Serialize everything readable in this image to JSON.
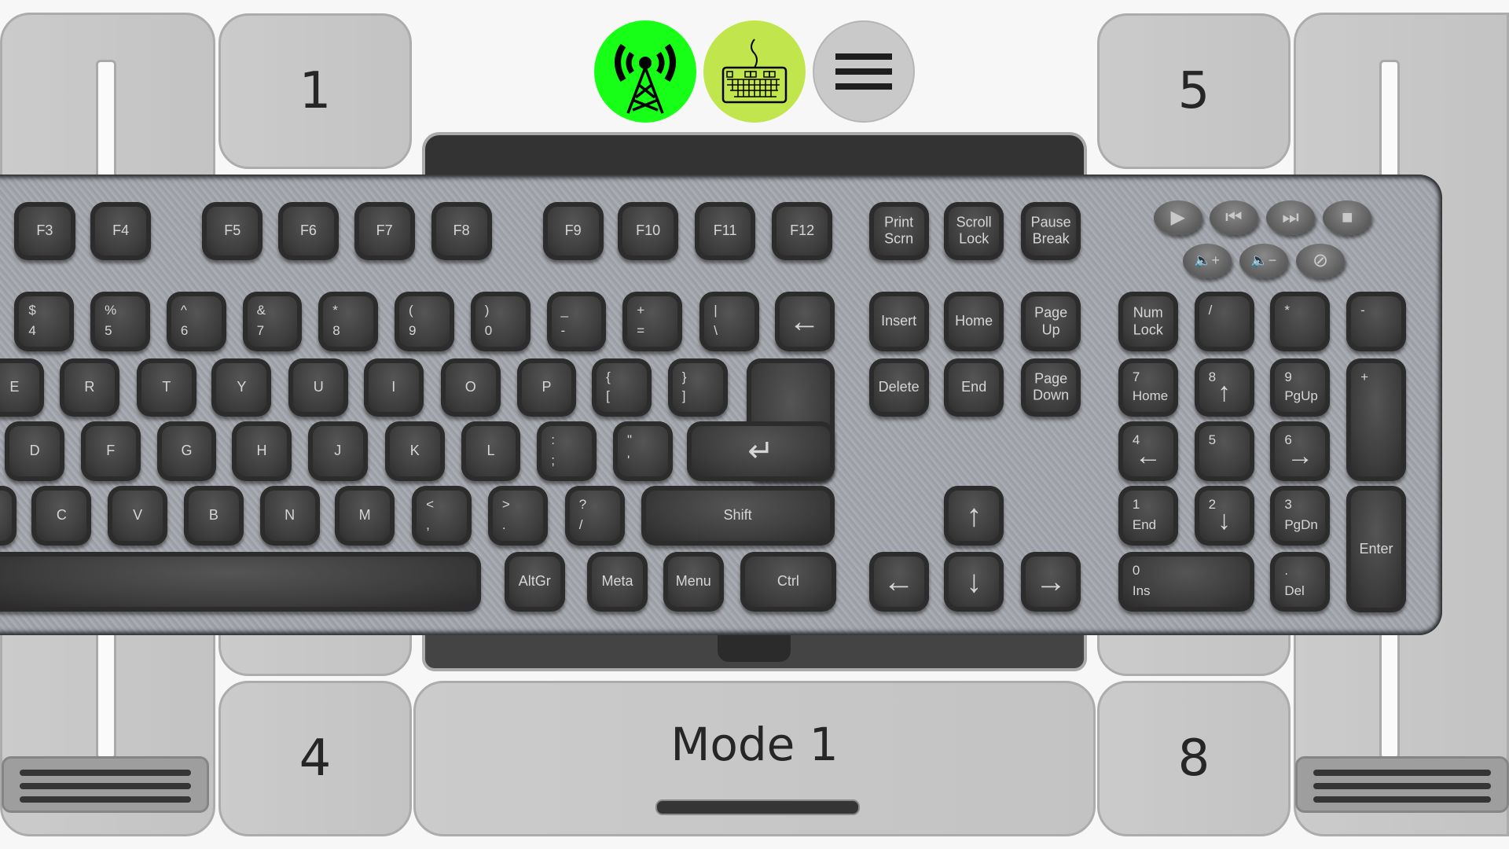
{
  "side_pads": {
    "top_left": "1",
    "top_right": "5",
    "bottom_left": "4",
    "bottom_right": "8",
    "mode_label": "Mode 1"
  },
  "top_buttons": {
    "connection": {
      "icon": "antenna-tower-icon",
      "color": "#17ff17"
    },
    "keyboard": {
      "icon": "keyboard-icon",
      "color": "#c1e54d"
    },
    "menu": {
      "icon": "hamburger-menu-icon",
      "color": "#c9c9c9"
    }
  },
  "keys": {
    "f": [
      "F3",
      "F4",
      "F5",
      "F6",
      "F7",
      "F8",
      "F9",
      "F10",
      "F11",
      "F12"
    ],
    "sys": [
      [
        "Print",
        "Scrn"
      ],
      [
        "Scroll",
        "Lock"
      ],
      [
        "Pause",
        "Break"
      ]
    ],
    "num_row": [
      [
        "$",
        "4"
      ],
      [
        "%",
        "5"
      ],
      [
        "^",
        "6"
      ],
      [
        "&",
        "7"
      ],
      [
        "*",
        "8"
      ],
      [
        "(",
        "9"
      ],
      [
        ")",
        "0"
      ],
      [
        "_",
        "-"
      ],
      [
        "+",
        "="
      ],
      [
        "|",
        "\\"
      ]
    ],
    "backspace": "←",
    "nav1": [
      "Insert",
      "Home",
      [
        "Page",
        "Up"
      ]
    ],
    "nav2": [
      "Delete",
      "End",
      [
        "Page",
        "Down"
      ]
    ],
    "q_row": [
      "E",
      "R",
      "T",
      "Y",
      "U",
      "I",
      "O",
      "P"
    ],
    "q_sym": [
      [
        "{",
        "["
      ],
      [
        "}",
        "]"
      ]
    ],
    "enter": "↵",
    "a_row": [
      "D",
      "F",
      "G",
      "H",
      "J",
      "K",
      "L"
    ],
    "a_sym": [
      [
        ":",
        ";"
      ],
      [
        "\"",
        "'"
      ]
    ],
    "z_row": [
      "C",
      "V",
      "B",
      "N",
      "M"
    ],
    "z_sym": [
      [
        "<",
        ","
      ],
      [
        ">",
        "."
      ],
      [
        "?",
        "/"
      ]
    ],
    "shift": "Shift",
    "bottom": [
      "AltGr",
      "Meta",
      "Menu",
      "Ctrl"
    ],
    "arrows": {
      "up": "↑",
      "down": "↓",
      "left": "←",
      "right": "→"
    },
    "numpad": {
      "numlock": [
        "Num",
        "Lock"
      ],
      "div": "/",
      "mul": "*",
      "minus": "-",
      "plus": "+",
      "n7": [
        "7",
        "Home"
      ],
      "n8": [
        "8",
        "↑"
      ],
      "n9": [
        "9",
        "PgUp"
      ],
      "n4": [
        "4",
        "←"
      ],
      "n5": "5",
      "n6": [
        "6",
        "→"
      ],
      "n1": [
        "1",
        "End"
      ],
      "n2": [
        "2",
        "↓"
      ],
      "n3": [
        "3",
        "PgDn"
      ],
      "n0": [
        "0",
        "Ins"
      ],
      "dot": [
        ".",
        "Del"
      ],
      "enter": "Enter"
    }
  },
  "media": {
    "play": "▶",
    "prev": "⏮",
    "next": "⏭",
    "stop": "■",
    "vol_up": "🔈+",
    "vol_down": "🔈−",
    "mute": "⊘"
  }
}
